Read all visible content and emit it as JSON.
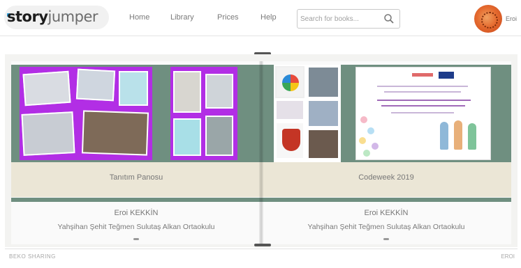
{
  "header": {
    "logo_bold": "story",
    "logo_thin": "jumper",
    "nav": [
      "Home",
      "Library",
      "Prices",
      "Help"
    ],
    "search_placeholder": "Search for books...",
    "user_name": "Eroi"
  },
  "book": {
    "left_page": {
      "caption": "Tanıtım Panosu",
      "author": "Eroi KEKKİN",
      "school": "Yahşihan Şehit Teğmen Sulutaş Alkan Ortaokulu"
    },
    "right_page": {
      "caption": "Codeweek 2019",
      "author": "Eroi KEKKİN",
      "school": "Yahşihan Şehit Teğmen Sulutaş Alkan Ortaokulu"
    }
  },
  "footer": {
    "left_label": "BEKO SHARING",
    "right_label": "EROI"
  },
  "colors": {
    "band": "#6f8f80",
    "caption_band": "#ebe6d6",
    "collage_purple": "#b22ee5",
    "avatar": "#e56b2f"
  },
  "icons": {
    "search": "search-icon",
    "avatar": "user-avatar"
  }
}
